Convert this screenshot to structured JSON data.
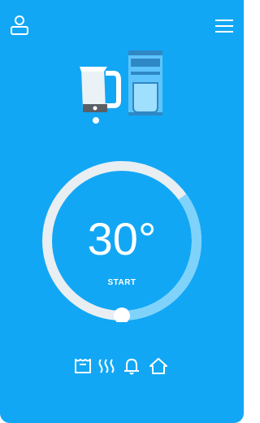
{
  "header": {
    "profile_icon": "user-icon",
    "menu_icon": "hamburger-menu-icon"
  },
  "appliances": {
    "items": [
      "kettle",
      "coffee-machine"
    ],
    "active_index": 0
  },
  "thermostat": {
    "temperature": "30°",
    "action_label": "START",
    "level": 0.35
  },
  "mode_icons": [
    "kettle-mode-icon",
    "heat-waves-icon",
    "bell-icon",
    "home-icon"
  ],
  "colors": {
    "background": "#12a7f5",
    "ring_track": "#e8eef1",
    "ring_progress": "#7fd3fb",
    "accent_white": "#ffffff"
  }
}
